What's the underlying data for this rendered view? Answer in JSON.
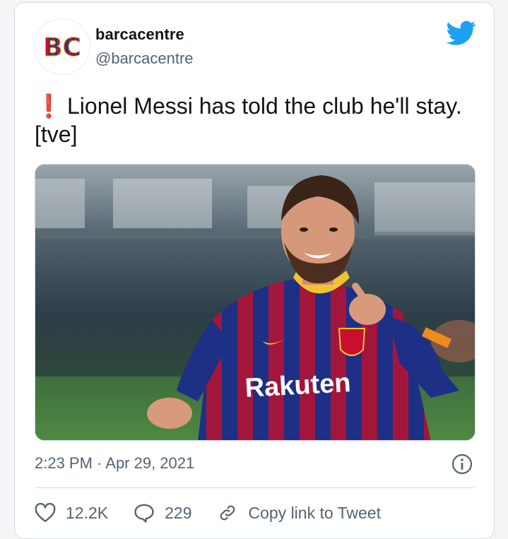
{
  "user": {
    "display_name": "barcacentre",
    "handle": "@barcacentre",
    "avatar_text": "BC"
  },
  "tweet": {
    "emoji": "❗",
    "text": "Lionel Messi has told the club he'll stay. [tve]",
    "timestamp": "2:23 PM · Apr 29, 2021",
    "media_jersey_text": "Rakuten"
  },
  "actions": {
    "like_count": "12.2K",
    "reply_count": "229",
    "copy_link_label": "Copy link to Tweet"
  },
  "colors": {
    "twitter_blue": "#1da1f2",
    "text_primary": "#0f1419",
    "text_secondary": "#536471",
    "alert_red": "#e0245e"
  },
  "icons": {
    "brand": "twitter-bird-icon",
    "info": "info-icon",
    "like": "heart-icon",
    "reply": "speech-bubble-icon",
    "link": "link-icon"
  }
}
